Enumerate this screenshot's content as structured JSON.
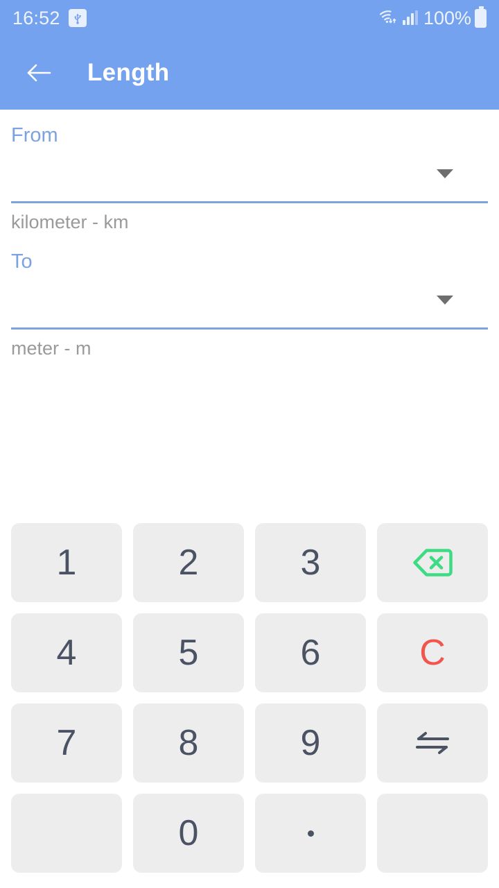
{
  "status_bar": {
    "time": "16:52",
    "usb_icon": "usb-icon",
    "wifi_icon": "wifi-icon",
    "signal_icon": "signal-bars-icon",
    "battery_percent": "100%",
    "battery_icon": "battery-full-icon"
  },
  "app_bar": {
    "back_icon": "arrow-left-icon",
    "title": "Length"
  },
  "converter": {
    "from": {
      "label": "From",
      "value": "",
      "hint": "kilometer - km",
      "dropdown_icon": "chevron-down-icon"
    },
    "to": {
      "label": "To",
      "value": "",
      "hint": "meter - m",
      "dropdown_icon": "chevron-down-icon"
    }
  },
  "keypad": {
    "keys": [
      {
        "id": "key-1",
        "label": "1",
        "type": "digit"
      },
      {
        "id": "key-2",
        "label": "2",
        "type": "digit"
      },
      {
        "id": "key-3",
        "label": "3",
        "type": "digit"
      },
      {
        "id": "key-backspace",
        "label": "",
        "type": "backspace",
        "icon": "backspace-icon"
      },
      {
        "id": "key-4",
        "label": "4",
        "type": "digit"
      },
      {
        "id": "key-5",
        "label": "5",
        "type": "digit"
      },
      {
        "id": "key-6",
        "label": "6",
        "type": "digit"
      },
      {
        "id": "key-clear",
        "label": "C",
        "type": "clear"
      },
      {
        "id": "key-7",
        "label": "7",
        "type": "digit"
      },
      {
        "id": "key-8",
        "label": "8",
        "type": "digit"
      },
      {
        "id": "key-9",
        "label": "9",
        "type": "digit"
      },
      {
        "id": "key-swap",
        "label": "",
        "type": "swap",
        "icon": "swap-arrows-icon"
      },
      {
        "id": "key-blank-left",
        "label": "",
        "type": "blank"
      },
      {
        "id": "key-0",
        "label": "0",
        "type": "digit"
      },
      {
        "id": "key-decimal",
        "label": ".",
        "type": "decimal"
      },
      {
        "id": "key-blank-right",
        "label": "",
        "type": "blank"
      }
    ]
  },
  "colors": {
    "header_blue": "#74a2ee",
    "label_blue": "#7ca3e0",
    "key_background": "#ededed",
    "key_text": "#4a5263",
    "clear_red": "#f1564e",
    "backspace_green": "#3ddc84",
    "hint_gray": "#9a9a9a"
  }
}
